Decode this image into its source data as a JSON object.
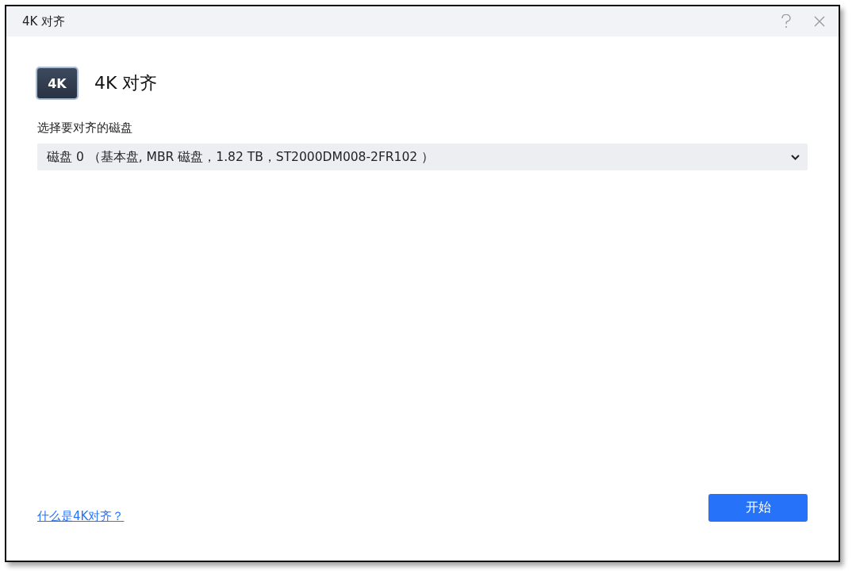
{
  "window": {
    "title": "4K 对齐"
  },
  "header": {
    "icon_text": "4K",
    "title": "4K 对齐"
  },
  "disk_select": {
    "label": "选择要对齐的磁盘",
    "value": "磁盘 0 （基本盘, MBR 磁盘，1.82 TB，ST2000DM008-2FR102 ）"
  },
  "help_link": "什么是4K对齐？",
  "buttons": [
    {
      "label": "开始",
      "kind": "primary"
    }
  ]
}
